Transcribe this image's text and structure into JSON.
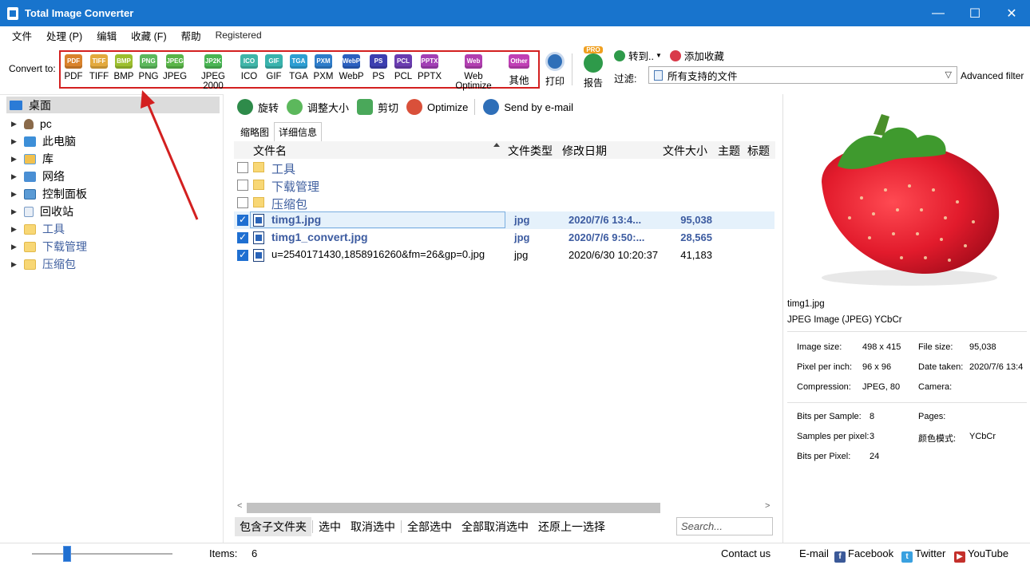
{
  "window": {
    "title": "Total Image Converter",
    "minimize": "—",
    "maximize": "☐",
    "close": "✕"
  },
  "menu": [
    "文件",
    "处理 (P)",
    "编辑",
    "收藏 (F)",
    "帮助",
    "Registered"
  ],
  "toolbar": {
    "convert_label": "Convert to:",
    "formats": [
      {
        "label": "PDF",
        "icon_text": "PDF",
        "color": "#d9822b"
      },
      {
        "label": "TIFF",
        "icon_text": "TIFF",
        "color": "#e3a93d"
      },
      {
        "label": "BMP",
        "icon_text": "BMP",
        "color": "#9cbf2e"
      },
      {
        "label": "PNG",
        "icon_text": "PNG",
        "color": "#5cb85c"
      },
      {
        "label": "JPEG",
        "icon_text": "JPEG",
        "color": "#59b548"
      },
      {
        "label": "JPEG 2000",
        "icon_text": "JP2K",
        "color": "#49b553"
      },
      {
        "label": "ICO",
        "icon_text": "ICO",
        "color": "#3fb5a8"
      },
      {
        "label": "GIF",
        "icon_text": "GIF",
        "color": "#39b3ad"
      },
      {
        "label": "TGA",
        "icon_text": "TGA",
        "color": "#2d9ed2"
      },
      {
        "label": "PXM",
        "icon_text": "PXM",
        "color": "#2e7cc9"
      },
      {
        "label": "WebP",
        "icon_text": "WebP",
        "color": "#2b5fbf"
      },
      {
        "label": "PS",
        "icon_text": "PS",
        "color": "#3c3fb0"
      },
      {
        "label": "PCL",
        "icon_text": "PCL",
        "color": "#6a3cb0"
      },
      {
        "label": "PPTX",
        "icon_text": "PPTX",
        "color": "#a23fb5"
      },
      {
        "label": "Web Optimize",
        "icon_text": "Web",
        "color": "#b13fb0"
      },
      {
        "label": "其他",
        "icon_text": "Other",
        "color": "#c03fb5"
      }
    ],
    "print_label": "打印",
    "report_label": "报告",
    "pro_badge": "PRO",
    "goto_label": "转到..",
    "favorite_label": "添加收藏",
    "filter_label": "过滤:",
    "filter_value": "所有支持的文件",
    "advanced_filter": "Advanced filter"
  },
  "tree": {
    "root": "桌面",
    "items": [
      {
        "label": "pc",
        "icon": "user-icon"
      },
      {
        "label": "此电脑",
        "icon": "computer-icon"
      },
      {
        "label": "库",
        "icon": "library-icon"
      },
      {
        "label": "网络",
        "icon": "network-icon"
      },
      {
        "label": "控制面板",
        "icon": "control-panel-icon"
      },
      {
        "label": "回收站",
        "icon": "recycle-bin-icon"
      },
      {
        "label": "工具",
        "icon": "folder-icon"
      },
      {
        "label": "下载管理",
        "icon": "folder-icon"
      },
      {
        "label": "压缩包",
        "icon": "folder-icon"
      }
    ]
  },
  "actions": {
    "rotate": "旋转",
    "resize": "调整大小",
    "crop": "剪切",
    "optimize": "Optimize",
    "email": "Send by e-mail"
  },
  "tabs": {
    "thumbnails": "缩略图",
    "details": "详细信息"
  },
  "columns": {
    "name": "文件名",
    "type": "文件类型",
    "modified": "修改日期",
    "size": "文件大小",
    "subject": "主题",
    "title": "标题"
  },
  "files": [
    {
      "name": "工具",
      "kind": "folder",
      "checked": false,
      "type": "",
      "date": "",
      "size": ""
    },
    {
      "name": "下载管理",
      "kind": "folder",
      "checked": false,
      "type": "",
      "date": "",
      "size": ""
    },
    {
      "name": "压缩包",
      "kind": "folder",
      "checked": false,
      "type": "",
      "date": "",
      "size": ""
    },
    {
      "name": "timg1.jpg",
      "kind": "image",
      "checked": true,
      "type": "jpg",
      "date": "2020/7/6 13:4...",
      "size": "95,038"
    },
    {
      "name": "timg1_convert.jpg",
      "kind": "image",
      "checked": true,
      "type": "jpg",
      "date": "2020/7/6 9:50:...",
      "size": "28,565"
    },
    {
      "name": "u=2540171430,1858916260&fm=26&gp=0.jpg",
      "kind": "image",
      "checked": true,
      "type": "jpg",
      "date": "2020/6/30 10:20:37",
      "size": "41,183"
    }
  ],
  "bottom_actions": {
    "include_subfolders": "包含子文件夹",
    "select": "选中",
    "deselect": "取消选中",
    "select_all": "全部选中",
    "deselect_all": "全部取消选中",
    "restore": "还原上一选择",
    "search_placeholder": "Search..."
  },
  "preview": {
    "filename": "timg1.jpg",
    "description": "JPEG Image (JPEG) YCbCr",
    "image_size_label": "Image size:",
    "image_size": "498 x 415",
    "file_size_label": "File size:",
    "file_size": "95,038",
    "ppi_label": "Pixel per inch:",
    "ppi": "96 x 96",
    "date_taken_label": "Date taken:",
    "date_taken": "2020/7/6 13:4",
    "compression_label": "Compression:",
    "compression": "JPEG, 80",
    "camera_label": "Camera:",
    "camera": "",
    "bps_label": "Bits per Sample:",
    "bps": "8",
    "pages_label": "Pages:",
    "pages": "",
    "spp_label": "Samples per pixel:",
    "spp": "3",
    "color_mode_label": "颜色模式:",
    "color_mode": "YCbCr",
    "bpp_label": "Bits per Pixel:",
    "bpp": "24"
  },
  "status": {
    "items_label": "Items:",
    "items_count": "6",
    "contact": "Contact us",
    "email": "E-mail",
    "facebook": "Facebook",
    "twitter": "Twitter",
    "youtube": "YouTube"
  }
}
